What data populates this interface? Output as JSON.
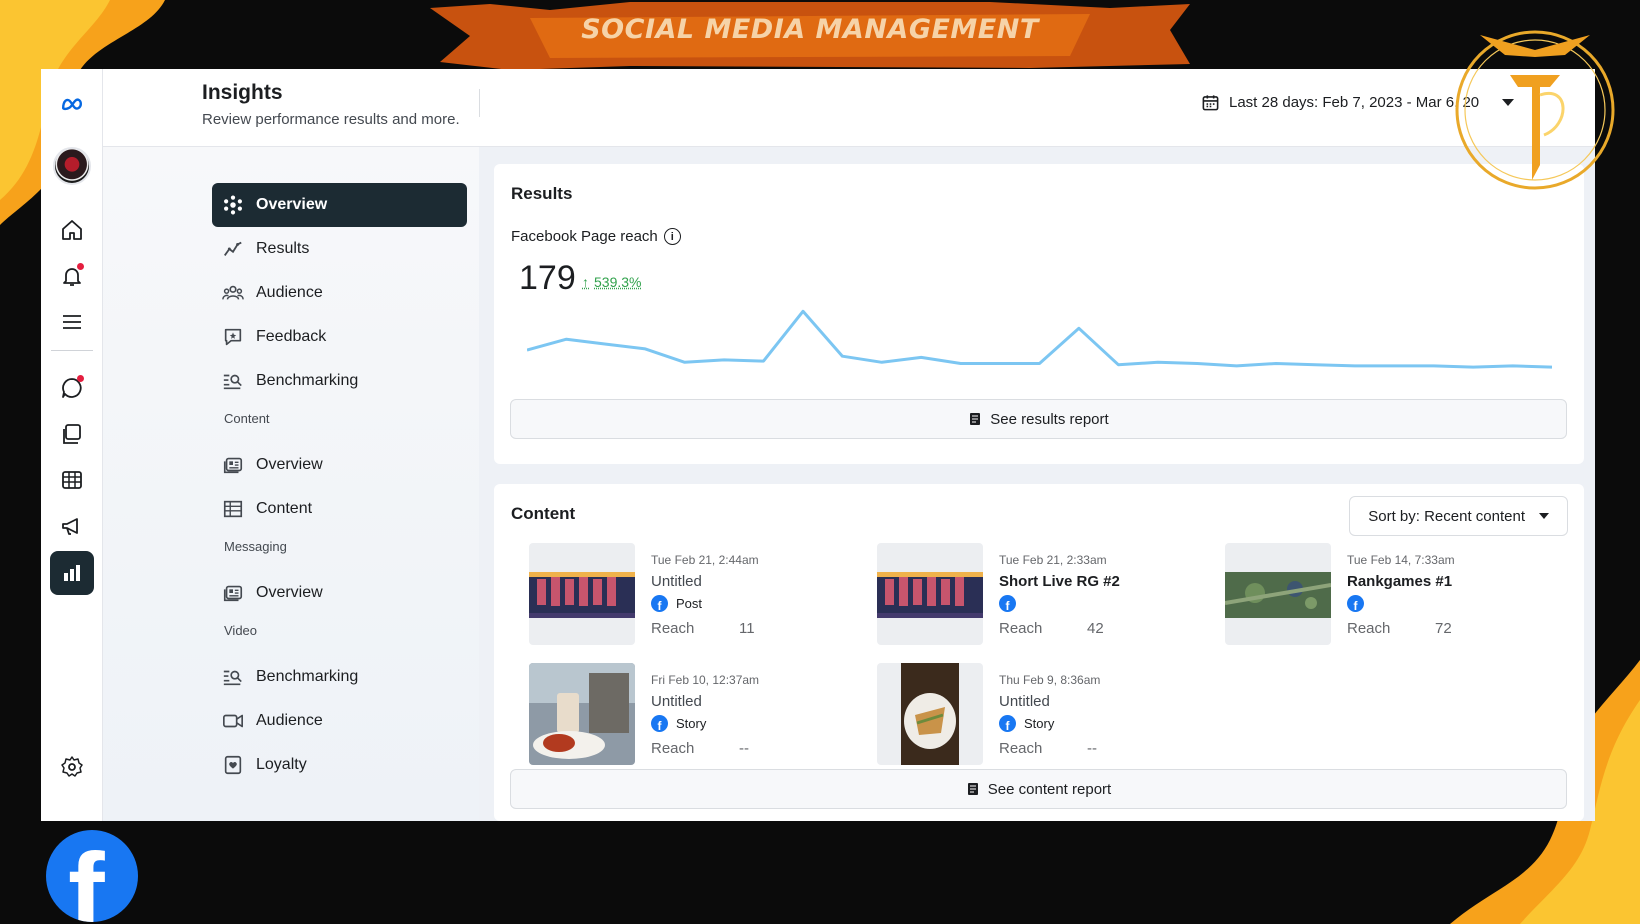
{
  "banner": {
    "title": "SOCIAL MEDIA MANAGEMENT"
  },
  "header": {
    "title": "Insights",
    "subtitle": "Review performance results and more.",
    "date_range": "Last 28 days: Feb 7, 2023 - Mar 6, 20"
  },
  "nav": {
    "items": [
      {
        "label": "Overview",
        "icon": "overview-icon",
        "active": true
      },
      {
        "label": "Results",
        "icon": "results-icon"
      },
      {
        "label": "Audience",
        "icon": "audience-icon"
      },
      {
        "label": "Feedback",
        "icon": "feedback-icon"
      },
      {
        "label": "Benchmarking",
        "icon": "benchmarking-icon"
      }
    ],
    "content_section": "Content",
    "content_items": [
      {
        "label": "Overview",
        "icon": "content-overview-icon"
      },
      {
        "label": "Content",
        "icon": "table-icon"
      }
    ],
    "messaging_section": "Messaging",
    "messaging_items": [
      {
        "label": "Overview",
        "icon": "messaging-overview-icon"
      }
    ],
    "video_section": "Video",
    "video_items": [
      {
        "label": "Benchmarking",
        "icon": "benchmarking-icon"
      },
      {
        "label": "Audience",
        "icon": "video-audience-icon"
      },
      {
        "label": "Loyalty",
        "icon": "loyalty-icon"
      }
    ]
  },
  "results": {
    "title": "Results",
    "metric_label": "Facebook Page reach",
    "value": "179",
    "delta": "539.3%",
    "delta_color": "#31a24c",
    "report_button": "See results report",
    "line_color": "#7cc6f2",
    "reach_series": [
      32,
      41,
      37,
      33,
      22,
      24,
      23,
      64,
      27,
      22,
      26,
      21,
      21,
      21,
      50,
      20,
      22,
      21,
      19,
      21,
      20,
      19,
      19,
      19,
      18,
      19,
      18
    ]
  },
  "content": {
    "title": "Content",
    "sort_label": "Sort by: Recent content",
    "report_button": "See content report",
    "posts": [
      {
        "date": "Tue Feb 21, 2:44am",
        "title": "Untitled",
        "type": "Post",
        "reach_label": "Reach",
        "reach": "11"
      },
      {
        "date": "Tue Feb 21, 2:33am",
        "title": "Short Live RG #2",
        "type": "",
        "reach_label": "Reach",
        "reach": "42"
      },
      {
        "date": "Tue Feb 14, 7:33am",
        "title": "Rankgames #1",
        "type": "",
        "reach_label": "Reach",
        "reach": "72"
      },
      {
        "date": "Fri Feb 10, 12:37am",
        "title": "Untitled",
        "type": "Story",
        "reach_label": "Reach",
        "reach": "--"
      },
      {
        "date": "Thu Feb 9, 8:36am",
        "title": "Untitled",
        "type": "Story",
        "reach_label": "Reach",
        "reach": "--"
      }
    ]
  },
  "colors": {
    "brand_dark": "#1c2b33",
    "facebook_blue": "#1877f2",
    "accent_orange": "#f39c12"
  }
}
